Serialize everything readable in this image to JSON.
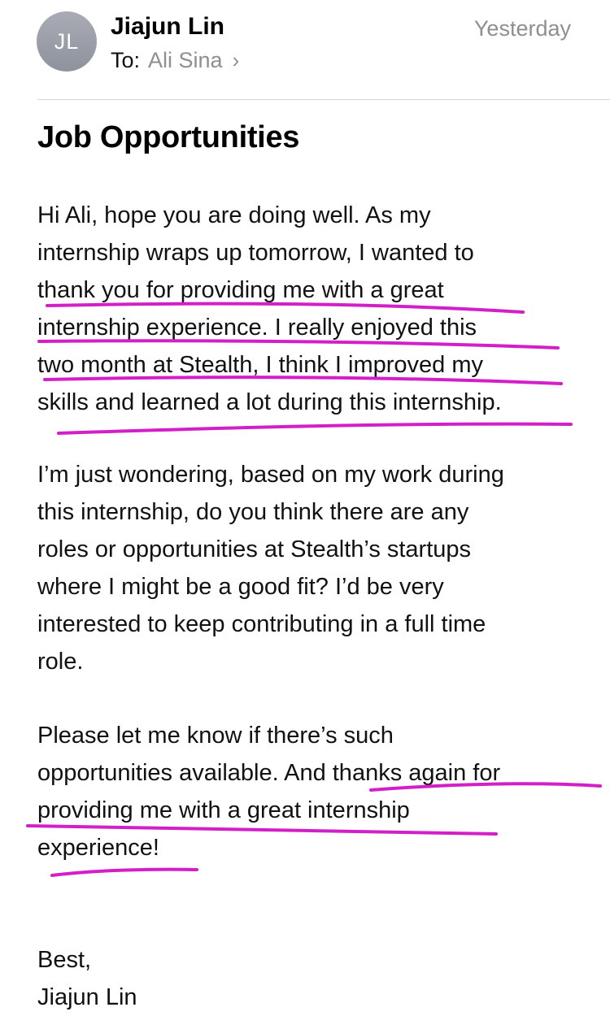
{
  "header": {
    "avatar_initials": "JL",
    "sender_name": "Jiajun Lin",
    "to_label": "To:",
    "recipient": "Ali Sina",
    "recipient_chevron": "›",
    "timestamp": "Yesterday"
  },
  "subject": "Job Opportunities",
  "body": {
    "paragraph1": [
      "Hi Ali, hope you are doing well. As my",
      "internship wraps up tomorrow, I wanted to",
      "thank you for providing me with a great",
      "internship experience. I really enjoyed this",
      "two month at Stealth, I think I improved my",
      "skills and learned a lot during this internship."
    ],
    "paragraph2": [
      "I’m just wondering, based on my work during",
      "this internship, do you think there are any",
      "roles or opportunities at Stealth’s startups",
      "where I might be a good fit? I’d be very",
      "interested to keep contributing in a full time",
      "role."
    ],
    "paragraph3": [
      "Please let me know if there’s such",
      "opportunities available. And thanks again for",
      "providing me with a great internship",
      "experience!"
    ],
    "signature": [
      "Best,",
      "Jiajun Lin"
    ]
  },
  "annotations": {
    "marker_color": "#d21fc7"
  }
}
